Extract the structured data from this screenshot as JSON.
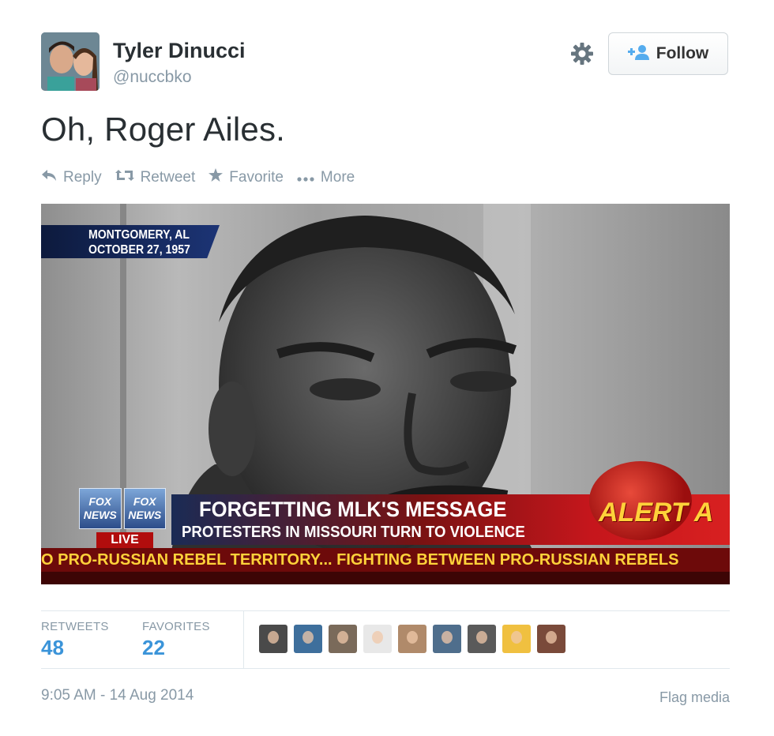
{
  "user": {
    "name": "Tyler Dinucci",
    "handle": "@nuccbko"
  },
  "header": {
    "settings_icon": "gear-icon",
    "follow_label": "Follow",
    "follow_icon": "add-person-icon"
  },
  "tweet": {
    "text": "Oh, Roger Ailes."
  },
  "actions": [
    {
      "label": "Reply",
      "icon": "reply-icon"
    },
    {
      "label": "Retweet",
      "icon": "retweet-icon"
    },
    {
      "label": "Favorite",
      "icon": "star-icon"
    },
    {
      "label": "More",
      "icon": "ellipsis-icon"
    }
  ],
  "media": {
    "location_line1": "MONTGOMERY, AL",
    "location_line2": "OCTOBER 27, 1957",
    "logo_line1": "FOX",
    "logo_line2": "NEWS",
    "live": "LIVE",
    "headline": "FORGETTING MLK'S MESSAGE",
    "subheadline": "PROTESTERS IN MISSOURI TURN TO VIOLENCE",
    "alert": "ALERT A",
    "ticker": "O PRO-RUSSIAN REBEL TERRITORY... FIGHTING BETWEEN PRO-RUSSIAN REBELS"
  },
  "stats": {
    "retweets_label": "RETWEETS",
    "retweets_value": "48",
    "favorites_label": "FAVORITES",
    "favorites_value": "22"
  },
  "favoriters": [
    {
      "color": "#4a4a4a"
    },
    {
      "color": "#3e6f9c"
    },
    {
      "color": "#7a6a5a"
    },
    {
      "color": "#e8e8e8"
    },
    {
      "color": "#b08a6a"
    },
    {
      "color": "#4f6e8c"
    },
    {
      "color": "#5a5a5a"
    },
    {
      "color": "#f0c040"
    },
    {
      "color": "#7a4a3a"
    }
  ],
  "footer": {
    "timestamp": "9:05 AM - 14 Aug 2014",
    "flag_label": "Flag media"
  },
  "colors": {
    "link_blue": "#3b94d9",
    "muted": "#8899a6",
    "text": "#292f33"
  }
}
